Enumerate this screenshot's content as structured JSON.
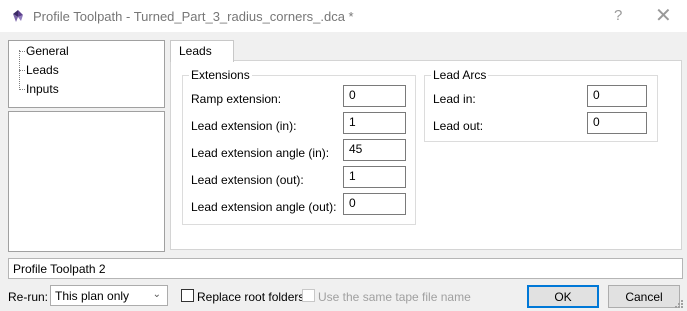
{
  "window": {
    "title": "Profile Toolpath - Turned_Part_3_radius_corners_.dca *",
    "help_glyph": "?",
    "close_glyph": "✕"
  },
  "tree": {
    "items": [
      {
        "label": "General"
      },
      {
        "label": "Leads"
      },
      {
        "label": "Inputs"
      }
    ]
  },
  "tabs": [
    {
      "label": "Leads"
    }
  ],
  "extensions": {
    "title": "Extensions",
    "fields": [
      {
        "label": "Ramp extension:",
        "value": "0"
      },
      {
        "label": "Lead extension (in):",
        "value": "1"
      },
      {
        "label": "Lead extension angle (in):",
        "value": "45"
      },
      {
        "label": "Lead extension (out):",
        "value": "1"
      },
      {
        "label": "Lead extension angle (out):",
        "value": "0"
      }
    ]
  },
  "lead_arcs": {
    "title": "Lead Arcs",
    "fields": [
      {
        "label": "Lead in:",
        "value": "0"
      },
      {
        "label": "Lead out:",
        "value": "0"
      }
    ]
  },
  "plan_name": "Profile Toolpath 2",
  "rerun": {
    "label": "Re-run:",
    "selected": "This plan only"
  },
  "options": {
    "replace_root_folders": {
      "label": "Replace root folders",
      "checked": false,
      "enabled": true
    },
    "same_tape_file": {
      "label": "Use the same tape file name",
      "checked": false,
      "enabled": false
    }
  },
  "buttons": {
    "ok": "OK",
    "cancel": "Cancel"
  },
  "colors": {
    "window_bg": "#f0f0f0",
    "panel_bg": "#ffffff",
    "default_button_border": "#0078d7",
    "icon_purple": "#5b3f8c"
  }
}
